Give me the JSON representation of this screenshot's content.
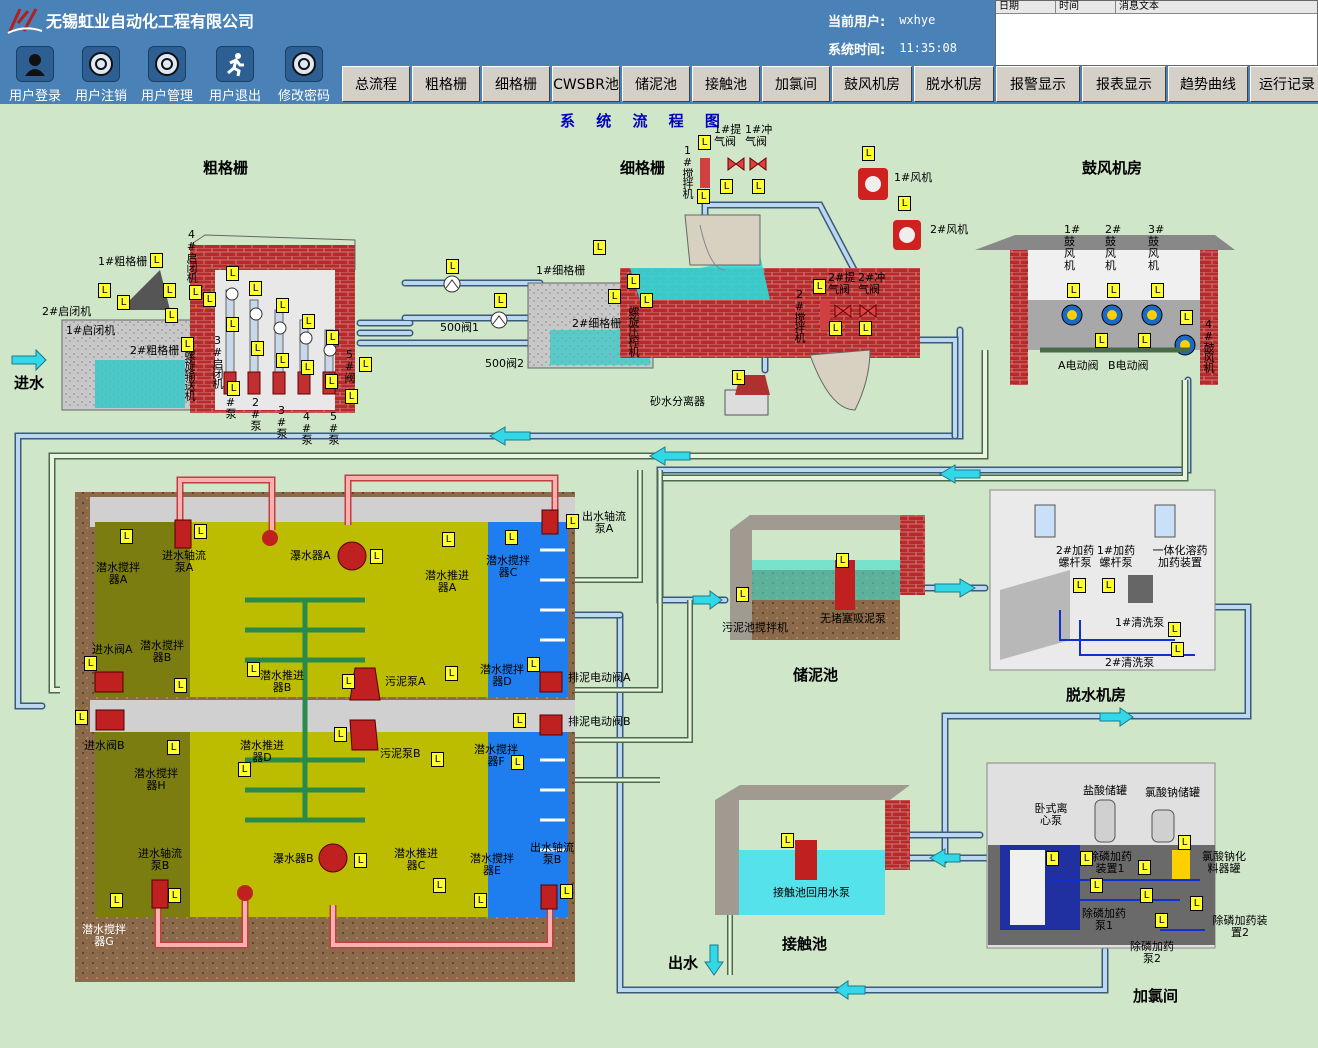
{
  "company": "无锡虹业自动化工程有限公司",
  "user": {
    "label": "当前用户:",
    "value": "wxhye"
  },
  "time": {
    "label": "系统时间:",
    "value": "11:35:08"
  },
  "messages": {
    "col_date": "日期",
    "col_time": "时间",
    "col_text": "消息文本"
  },
  "toolbar": [
    "用户登录",
    "用户注销",
    "用户管理",
    "用户退出",
    "修改密码"
  ],
  "tabs": [
    "总流程",
    "粗格栅",
    "细格栅",
    "CWSBR池",
    "储泥池",
    "接触池",
    "加氯间",
    "鼓风机房",
    "脱水机房",
    "报警显示",
    "报表显示",
    "趋势曲线",
    "运行记录"
  ],
  "page_title": "系 统 流 程 图",
  "sections": {
    "coarse": "粗格栅",
    "fine": "细格栅",
    "blower": "鼓风机房",
    "sludge": "储泥池",
    "dewater": "脱水机房",
    "contact": "接触池",
    "chlorine": "加氯间",
    "inlet": "进水",
    "outlet": "出水"
  },
  "labels": {
    "gate1": "1#启闭机",
    "gate2": "2#启闭机",
    "grid1": "1#粗格栅",
    "grid2": "2#粗格栅",
    "gate3": "3#启闭机",
    "gate4": "4#启闭机",
    "screw_conv": "螺旋输送机",
    "pump1": "1#泵",
    "pump2": "2#泵",
    "pump3": "3#泵",
    "pump4": "4#泵",
    "pump5": "5#泵",
    "valve5": "5#阀",
    "v500_1": "500阀1",
    "v500_2": "500阀2",
    "fgrid1": "1#细格栅",
    "fgrid2": "2#细格栅",
    "screw_press": "螺旋压榨机",
    "sand_sep": "砂水分离器",
    "mixer1": "1#搅拌机",
    "mixer2": "2#搅拌机",
    "air_valve1": "1#提气阀",
    "flush_valve1": "1#冲气阀",
    "air_valve2": "2#提气阀",
    "flush_valve2": "2#冲气阀",
    "fan1": "1#风机",
    "fan2": "2#风机",
    "blower1": "1#鼓风机",
    "blower2": "2#鼓风机",
    "blower3": "3#鼓风机",
    "blower4": "4#鼓风机",
    "valveA": "A电动阀",
    "valveB": "B电动阀",
    "sub_mixA": "潜水搅拌器A",
    "axial_inA": "进水轴流泵A",
    "aerA": "瀑水器A",
    "propA": "潜水推进器A",
    "sub_mixC": "潜水搅拌器C",
    "out_axialA": "出水轴流泵A",
    "in_valveA": "进水阀A",
    "sub_mixB": "潜水搅拌器B",
    "propB": "潜水推进器B",
    "sludge_pumpA": "污泥泵A",
    "sub_mixD": "潜水搅拌器D",
    "drain_valveA": "排泥电动阀A",
    "in_valveB": "进水阀B",
    "drain_valveB": "排泥电动阀B",
    "propD": "潜水推进器D",
    "sludge_pumpB": "污泥泵B",
    "sub_mixF": "潜水搅拌器F",
    "sub_mixH": "潜水搅拌器H",
    "axial_inB": "进水轴流泵B",
    "aerB": "瀑水器B",
    "propC": "潜水推进器C",
    "sub_mixE": "潜水搅拌器E",
    "out_axialB": "出水轴流泵B",
    "sub_mixG": "潜水搅拌器G",
    "sludge_mixer": "污泥池搅拌机",
    "sludge_suction": "无堵塞吸泥泵",
    "screw_pump2": "2#加药螺杆泵",
    "screw_pump1": "1#加药螺杆泵",
    "integrated": "一体化溶药加药装置",
    "wash1": "1#清洗泵",
    "wash2": "2#清洗泵",
    "reuse_pump": "接触池回用水泵",
    "centrifuge": "卧式离心泵",
    "hcl_tank": "盐酸储罐",
    "naclo3_tank": "氯酸钠储罐",
    "dephos1": "除磷加药装置1",
    "dephos2": "除磷加药装置2",
    "naclo3_mix": "氯酸钠化料器罐",
    "dephos_pump1": "除磷加药泵1",
    "dephos_pump2": "除磷加药泵2"
  },
  "status_badge": "L",
  "colors": {
    "bg": "#cfe6c9",
    "topbar": "#4a82b8",
    "pipe": "#5a9ad8",
    "badge": "#ffff30",
    "title": "#0000c0"
  }
}
